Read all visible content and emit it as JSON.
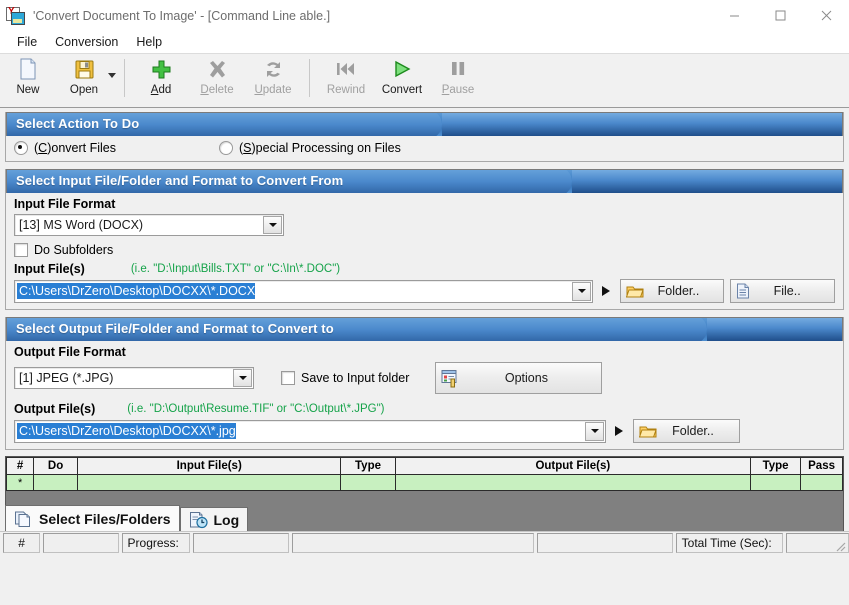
{
  "window": {
    "title": "'Convert Document To Image' - [Command Line able.]",
    "icon": "app-convert-icon",
    "minimize": "minimize-icon",
    "maximize": "maximize-icon",
    "close": "close-icon"
  },
  "menu": {
    "items": [
      {
        "label": "File"
      },
      {
        "label": "Conversion"
      },
      {
        "label": "Help"
      }
    ]
  },
  "toolbar": {
    "buttons": [
      {
        "label": "New",
        "icon": "new-document-icon",
        "enabled": true,
        "accel": ""
      },
      {
        "label": "Open",
        "icon": "save-floppy-icon",
        "enabled": true,
        "accel": ""
      },
      {
        "label": "Add",
        "icon": "plus-icon",
        "enabled": true,
        "accel": "A"
      },
      {
        "label": "Delete",
        "icon": "x-cross-icon",
        "enabled": false,
        "accel": "D"
      },
      {
        "label": "Update",
        "icon": "refresh-icon",
        "enabled": false,
        "accel": "U"
      },
      {
        "label": "Rewind",
        "icon": "rewind-icon",
        "enabled": false,
        "accel": ""
      },
      {
        "label": "Convert",
        "icon": "play-icon",
        "enabled": true,
        "accel": ""
      },
      {
        "label": "Pause",
        "icon": "pause-icon",
        "enabled": false,
        "accel": "P"
      }
    ],
    "dropdown_icon": "chevron-down-icon"
  },
  "action_panel": {
    "header": "Select Action To Do",
    "options": [
      {
        "prefix": "(",
        "accel": "C",
        "suffix": ")onvert Files",
        "selected": true
      },
      {
        "prefix": "(",
        "accel": "S",
        "suffix": ")pecial Processing on Files",
        "selected": false
      }
    ]
  },
  "input_panel": {
    "header": "Select Input File/Folder and Format to Convert From",
    "format_label": "Input File Format",
    "format_value": "[13] MS Word (DOCX)",
    "subfolders_label": "Do Subfolders",
    "subfolders_checked": false,
    "files_label": "Input File(s)",
    "files_hint": "(i.e. \"D:\\Input\\Bills.TXT\"  or \"C:\\In\\*.DOC\")",
    "files_value": "C:\\Users\\DrZero\\Desktop\\DOCXX\\*.DOCX",
    "folder_button": "Folder..",
    "folder_icon": "open-folder-icon",
    "file_button": "File..",
    "file_icon": "document-icon",
    "dropdown_icon": "chevron-down-icon",
    "play_icon": "play-triangle-icon"
  },
  "output_panel": {
    "header": "Select Output File/Folder and Format to Convert to",
    "format_label": "Output File Format",
    "format_value": "[1] JPEG (*.JPG)",
    "save_to_input_label": "Save to Input folder",
    "save_to_input_checked": false,
    "options_button": "Options",
    "options_icon": "options-properties-icon",
    "files_label": "Output File(s)",
    "files_hint": "(i.e. \"D:\\Output\\Resume.TIF\" or \"C:\\Output\\*.JPG\")",
    "files_value": "C:\\Users\\DrZero\\Desktop\\DOCXX\\*.jpg",
    "folder_button": "Folder..",
    "folder_icon": "open-folder-icon",
    "dropdown_icon": "chevron-down-icon",
    "play_icon": "play-triangle-icon"
  },
  "grid": {
    "columns": [
      "#",
      "Do",
      "Input File(s)",
      "Type",
      "Output File(s)",
      "Type",
      "Pass"
    ],
    "rows": [
      {
        "num": "*",
        "do": "",
        "input": "",
        "intype": "",
        "output": "",
        "outtype": "",
        "pass": ""
      }
    ]
  },
  "tabs": [
    {
      "label": "Select Files/Folders",
      "icon": "copy-pages-icon",
      "active": true
    },
    {
      "label": "Log",
      "icon": "log-clock-icon",
      "active": false
    }
  ],
  "statusbar": {
    "hash_label": "#",
    "count_value": "",
    "progress_label": "Progress:",
    "progress_value": "",
    "message_value": "",
    "bar_value": "",
    "total_time_label": "Total Time (Sec):",
    "total_time_value": "",
    "resize_grip_icon": "resize-grip-icon"
  },
  "colors": {
    "header_blue": "#3f7fc4",
    "selection_blue": "#2a7fd4",
    "hint_green": "#16a34a",
    "grid_row_green": "#c8f0c0",
    "toolbar_bg": "#f1f1f1"
  }
}
